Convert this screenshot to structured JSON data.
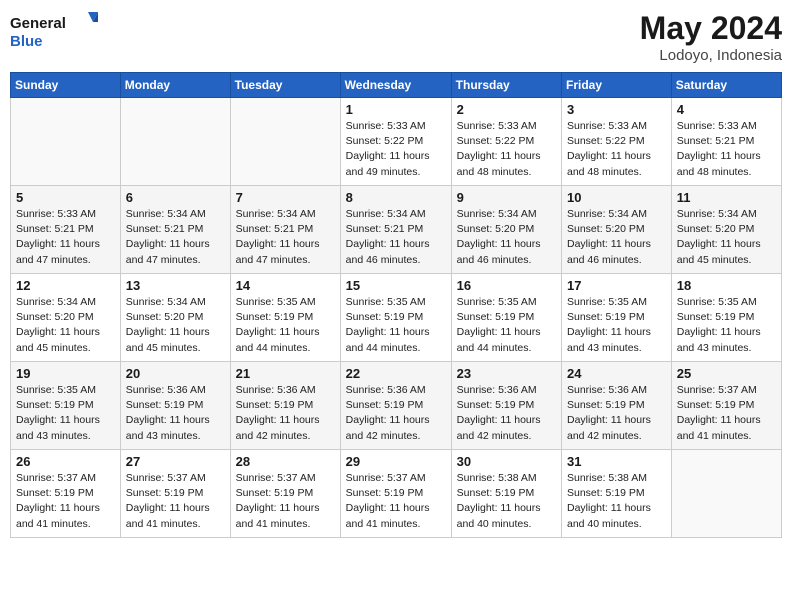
{
  "logo": {
    "line1": "General",
    "line2": "Blue"
  },
  "title": {
    "month_year": "May 2024",
    "location": "Lodoyo, Indonesia"
  },
  "weekdays": [
    "Sunday",
    "Monday",
    "Tuesday",
    "Wednesday",
    "Thursday",
    "Friday",
    "Saturday"
  ],
  "weeks": [
    [
      {
        "day": "",
        "info": ""
      },
      {
        "day": "",
        "info": ""
      },
      {
        "day": "",
        "info": ""
      },
      {
        "day": "1",
        "info": "Sunrise: 5:33 AM\nSunset: 5:22 PM\nDaylight: 11 hours\nand 49 minutes."
      },
      {
        "day": "2",
        "info": "Sunrise: 5:33 AM\nSunset: 5:22 PM\nDaylight: 11 hours\nand 48 minutes."
      },
      {
        "day": "3",
        "info": "Sunrise: 5:33 AM\nSunset: 5:22 PM\nDaylight: 11 hours\nand 48 minutes."
      },
      {
        "day": "4",
        "info": "Sunrise: 5:33 AM\nSunset: 5:21 PM\nDaylight: 11 hours\nand 48 minutes."
      }
    ],
    [
      {
        "day": "5",
        "info": "Sunrise: 5:33 AM\nSunset: 5:21 PM\nDaylight: 11 hours\nand 47 minutes."
      },
      {
        "day": "6",
        "info": "Sunrise: 5:34 AM\nSunset: 5:21 PM\nDaylight: 11 hours\nand 47 minutes."
      },
      {
        "day": "7",
        "info": "Sunrise: 5:34 AM\nSunset: 5:21 PM\nDaylight: 11 hours\nand 47 minutes."
      },
      {
        "day": "8",
        "info": "Sunrise: 5:34 AM\nSunset: 5:21 PM\nDaylight: 11 hours\nand 46 minutes."
      },
      {
        "day": "9",
        "info": "Sunrise: 5:34 AM\nSunset: 5:20 PM\nDaylight: 11 hours\nand 46 minutes."
      },
      {
        "day": "10",
        "info": "Sunrise: 5:34 AM\nSunset: 5:20 PM\nDaylight: 11 hours\nand 46 minutes."
      },
      {
        "day": "11",
        "info": "Sunrise: 5:34 AM\nSunset: 5:20 PM\nDaylight: 11 hours\nand 45 minutes."
      }
    ],
    [
      {
        "day": "12",
        "info": "Sunrise: 5:34 AM\nSunset: 5:20 PM\nDaylight: 11 hours\nand 45 minutes."
      },
      {
        "day": "13",
        "info": "Sunrise: 5:34 AM\nSunset: 5:20 PM\nDaylight: 11 hours\nand 45 minutes."
      },
      {
        "day": "14",
        "info": "Sunrise: 5:35 AM\nSunset: 5:19 PM\nDaylight: 11 hours\nand 44 minutes."
      },
      {
        "day": "15",
        "info": "Sunrise: 5:35 AM\nSunset: 5:19 PM\nDaylight: 11 hours\nand 44 minutes."
      },
      {
        "day": "16",
        "info": "Sunrise: 5:35 AM\nSunset: 5:19 PM\nDaylight: 11 hours\nand 44 minutes."
      },
      {
        "day": "17",
        "info": "Sunrise: 5:35 AM\nSunset: 5:19 PM\nDaylight: 11 hours\nand 43 minutes."
      },
      {
        "day": "18",
        "info": "Sunrise: 5:35 AM\nSunset: 5:19 PM\nDaylight: 11 hours\nand 43 minutes."
      }
    ],
    [
      {
        "day": "19",
        "info": "Sunrise: 5:35 AM\nSunset: 5:19 PM\nDaylight: 11 hours\nand 43 minutes."
      },
      {
        "day": "20",
        "info": "Sunrise: 5:36 AM\nSunset: 5:19 PM\nDaylight: 11 hours\nand 43 minutes."
      },
      {
        "day": "21",
        "info": "Sunrise: 5:36 AM\nSunset: 5:19 PM\nDaylight: 11 hours\nand 42 minutes."
      },
      {
        "day": "22",
        "info": "Sunrise: 5:36 AM\nSunset: 5:19 PM\nDaylight: 11 hours\nand 42 minutes."
      },
      {
        "day": "23",
        "info": "Sunrise: 5:36 AM\nSunset: 5:19 PM\nDaylight: 11 hours\nand 42 minutes."
      },
      {
        "day": "24",
        "info": "Sunrise: 5:36 AM\nSunset: 5:19 PM\nDaylight: 11 hours\nand 42 minutes."
      },
      {
        "day": "25",
        "info": "Sunrise: 5:37 AM\nSunset: 5:19 PM\nDaylight: 11 hours\nand 41 minutes."
      }
    ],
    [
      {
        "day": "26",
        "info": "Sunrise: 5:37 AM\nSunset: 5:19 PM\nDaylight: 11 hours\nand 41 minutes."
      },
      {
        "day": "27",
        "info": "Sunrise: 5:37 AM\nSunset: 5:19 PM\nDaylight: 11 hours\nand 41 minutes."
      },
      {
        "day": "28",
        "info": "Sunrise: 5:37 AM\nSunset: 5:19 PM\nDaylight: 11 hours\nand 41 minutes."
      },
      {
        "day": "29",
        "info": "Sunrise: 5:37 AM\nSunset: 5:19 PM\nDaylight: 11 hours\nand 41 minutes."
      },
      {
        "day": "30",
        "info": "Sunrise: 5:38 AM\nSunset: 5:19 PM\nDaylight: 11 hours\nand 40 minutes."
      },
      {
        "day": "31",
        "info": "Sunrise: 5:38 AM\nSunset: 5:19 PM\nDaylight: 11 hours\nand 40 minutes."
      },
      {
        "day": "",
        "info": ""
      }
    ]
  ]
}
